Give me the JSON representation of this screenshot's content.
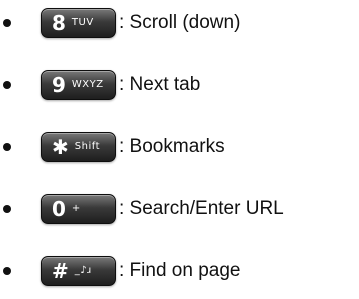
{
  "items": [
    {
      "key_main": "8",
      "key_sub": "TUV",
      "label": ": Scroll (down)"
    },
    {
      "key_main": "9",
      "key_sub": "WXYZ",
      "label": ": Next tab"
    },
    {
      "key_main": "✱",
      "key_sub": "Shift",
      "label": ": Bookmarks"
    },
    {
      "key_main": "0",
      "key_sub": "+",
      "label": ": Search/Enter URL"
    },
    {
      "key_main": "#",
      "key_sub": "_♪ɹ",
      "label": ": Find on page"
    }
  ],
  "colors": {
    "key_face": "#2a2a2a",
    "text": "#111111",
    "background": "#ffffff"
  }
}
